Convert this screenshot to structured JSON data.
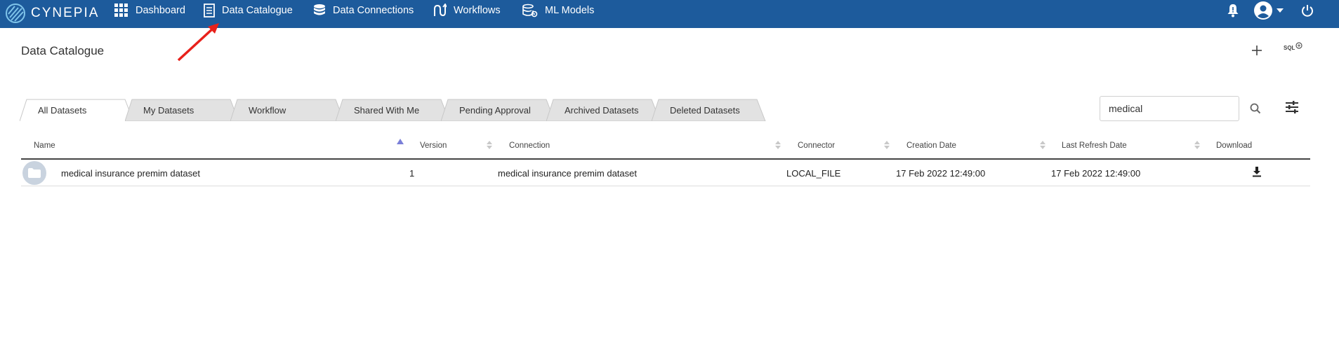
{
  "app": {
    "brand": "CYNEPIA"
  },
  "nav": {
    "items": [
      {
        "label": "Dashboard",
        "icon": "grid-icon"
      },
      {
        "label": "Data Catalogue",
        "icon": "document-icon"
      },
      {
        "label": "Data Connections",
        "icon": "database-icon"
      },
      {
        "label": "Workflows",
        "icon": "workflow-icon"
      },
      {
        "label": "ML Models",
        "icon": "ml-models-icon"
      }
    ]
  },
  "page": {
    "title": "Data Catalogue",
    "sql_label": "SQL"
  },
  "tabs": [
    {
      "label": "All Datasets",
      "active": true
    },
    {
      "label": "My Datasets",
      "active": false
    },
    {
      "label": "Workflow",
      "active": false
    },
    {
      "label": "Shared With Me",
      "active": false
    },
    {
      "label": "Pending Approval",
      "active": false
    },
    {
      "label": "Archived Datasets",
      "active": false
    },
    {
      "label": "Deleted Datasets",
      "active": false
    }
  ],
  "search": {
    "value": "medical"
  },
  "table": {
    "columns": [
      "Name",
      "Version",
      "Connection",
      "Connector",
      "Creation Date",
      "Last Refresh Date",
      "Download"
    ],
    "rows": [
      {
        "name": "medical insurance premim dataset",
        "version": "1",
        "connection": "medical insurance premim dataset",
        "connector": "LOCAL_FILE",
        "creation_date": "17 Feb 2022 12:49:00",
        "last_refresh_date": "17 Feb 2022 12:49:00"
      }
    ]
  },
  "colors": {
    "topbar": "#1d5b9c",
    "arrow": "#e8211b",
    "tab_inactive": "#e2e2e2",
    "sort_active": "#7a7fd8"
  }
}
